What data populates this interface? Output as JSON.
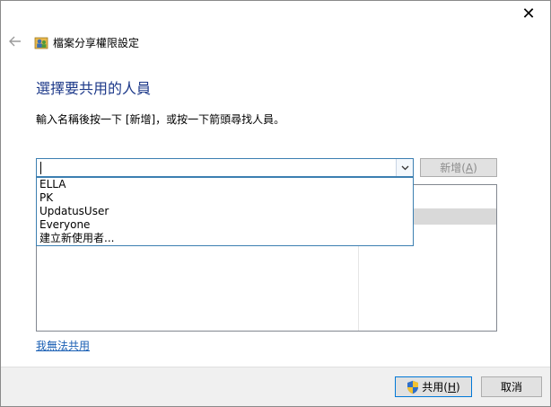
{
  "window": {
    "title": "檔案分享權限設定",
    "close_glyph": "✕",
    "back_glyph": "←"
  },
  "main": {
    "heading": "選擇要共用的人員",
    "instruction": "輸入名稱後按一下 [新增]，或按一下箭頭尋找人員。"
  },
  "combo": {
    "value": "",
    "add_button": {
      "text": "新增(",
      "mnemonic": "A",
      "end": ")"
    }
  },
  "dropdown": {
    "items": [
      "ELLA",
      "PK",
      "UpdatusUser",
      "Everyone",
      "建立新使用者..."
    ]
  },
  "help_link": "我無法共用",
  "footer": {
    "share_button": {
      "text": "共用(",
      "mnemonic": "H",
      "end": ")"
    },
    "cancel_button": "取消"
  },
  "colors": {
    "heading": "#1e3a8a",
    "link": "#1a5fb4",
    "focus_border": "#3c7fb1"
  }
}
